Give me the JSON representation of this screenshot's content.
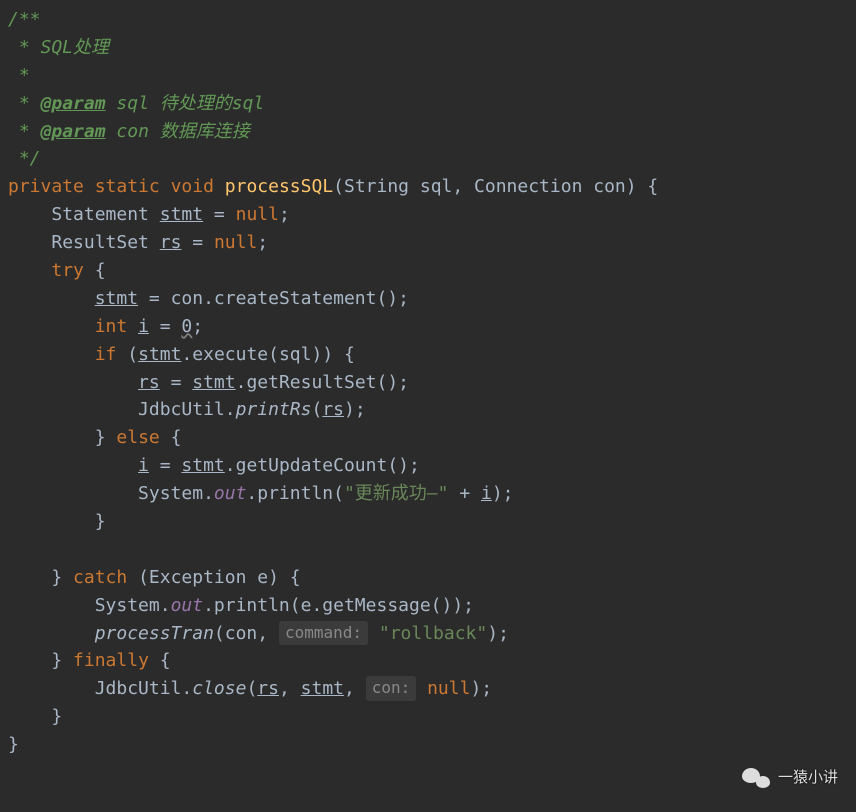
{
  "code": {
    "doc_open": "/**",
    "doc_title": " * SQL处理",
    "doc_blank": " *",
    "doc_param1_tag": "@param",
    "doc_param1_name": "sql",
    "doc_param1_desc": "待处理的sql",
    "doc_param2_tag": "@param",
    "doc_param2_name": "con",
    "doc_param2_desc": "数据库连接",
    "doc_close": " */",
    "kw_private": "private",
    "kw_static": "static",
    "kw_void": "void",
    "method_name": "processSQL",
    "sig_open": "(String sql, Connection con) {",
    "decl_stmt_type": "Statement ",
    "decl_stmt_var": "stmt",
    "decl_stmt_rest": " = ",
    "kw_null": "null",
    "semicolon": ";",
    "decl_rs_type": "ResultSet ",
    "decl_rs_var": "rs",
    "kw_try": "try",
    "brace_open": " {",
    "assign_stmt_var": "stmt",
    "assign_stmt_rest": " = con.createStatement();",
    "kw_int": "int",
    "decl_i_var": "i",
    "decl_i_eq": " = ",
    "decl_i_zero": "0",
    "kw_if": "if",
    "if_open": " (",
    "if_stmt": "stmt",
    "if_exec": ".execute(sql)) {",
    "rs_var": "rs",
    "rs_eq": " = ",
    "rs_stmt": "stmt",
    "rs_get": ".getResultSet();",
    "jdbc_print_call": "JdbcUtil.",
    "jdbc_print_method": "printRs",
    "jdbc_print_open": "(",
    "jdbc_print_arg": "rs",
    "jdbc_print_close": ");",
    "brace_close": "}",
    "kw_else": "else",
    "i_var": "i",
    "i_eq": " = ",
    "i_stmt": "stmt",
    "i_getupdate": ".getUpdateCount();",
    "sysout_prefix": "System.",
    "sysout_out": "out",
    "sysout_println": ".println(",
    "sysout_str": "\"更新成功–\"",
    "sysout_plus": " + ",
    "sysout_i": "i",
    "sysout_close": ");",
    "kw_catch": "catch",
    "catch_sig": " (Exception e) {",
    "catch_println_arg": "e.getMessage());",
    "processTran_call": "processTran",
    "processTran_open": "(con, ",
    "hint_command": "command:",
    "str_rollback": "\"rollback\"",
    "processTran_close": ");",
    "kw_finally": "finally",
    "jdbc_close_class": "JdbcUtil.",
    "jdbc_close_method": "close",
    "jdbc_close_open": "(",
    "jdbc_close_rs": "rs",
    "jdbc_close_comma1": ", ",
    "jdbc_close_stmt": "stmt",
    "jdbc_close_comma2": ", ",
    "hint_con": "con:",
    "jdbc_close_close": ");"
  },
  "watermark": "一猿小讲"
}
